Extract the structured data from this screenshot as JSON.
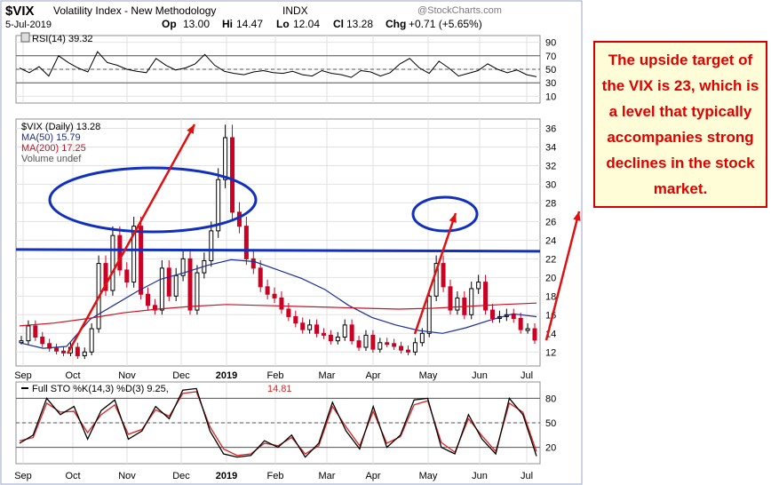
{
  "header": {
    "symbol": "$VIX",
    "name": "Volatility Index - New Methodology",
    "exchange": "INDX",
    "date": "5-Jul-2019",
    "watermark": "@StockCharts.com",
    "quote": {
      "op_label": "Op",
      "op": "13.00",
      "hi_label": "Hi",
      "hi": "14.47",
      "lo_label": "Lo",
      "lo": "12.04",
      "cl_label": "Cl",
      "cl": "13.28",
      "chg_label": "Chg",
      "chg": "+0.71 (+5.65%)"
    }
  },
  "callout_text": "The upside target of the VIX is 23, which is a level that typically accompanies strong declines in the stock market.",
  "colors": {
    "up": "#000000",
    "down": "#cc0022",
    "ma50": "#1a2e9a",
    "ma200": "#cc1122",
    "annotation_blue": "#1030c0",
    "annotation_red": "#e01010",
    "kline": "#000000",
    "dline": "#dd2222"
  },
  "chart_data": [
    {
      "type": "line",
      "title": "RSI(14) 39.32",
      "legend": [
        "RSI(14) 39.32"
      ],
      "yticks": [
        10,
        30,
        50,
        70,
        90
      ],
      "ylim": [
        0,
        100
      ],
      "guides": [
        30,
        50,
        70
      ],
      "x": [
        "Sep",
        "Oct",
        "Nov",
        "Dec",
        "2019",
        "Feb",
        "Mar",
        "Apr",
        "May",
        "Jun",
        "Jul"
      ],
      "series": [
        {
          "name": "RSI(14)",
          "values": [
            52,
            45,
            54,
            40,
            70,
            60,
            52,
            46,
            76,
            60,
            56,
            50,
            47,
            45,
            66,
            56,
            49,
            52,
            58,
            72,
            56,
            47,
            44,
            42,
            46,
            48,
            45,
            44,
            47,
            42,
            40,
            48,
            44,
            42,
            38,
            48,
            46,
            40,
            45,
            58,
            66,
            52,
            44,
            62,
            52,
            40,
            44,
            48,
            58,
            50,
            45,
            49,
            42,
            39
          ]
        }
      ]
    },
    {
      "type": "candlestick",
      "title": "$VIX (Daily) 13.28",
      "legend": [
        "$VIX (Daily) 13.28",
        "MA(50) 15.79",
        "MA(200) 17.25",
        "Volume undef"
      ],
      "yticks": [
        12,
        14,
        16,
        18,
        20,
        22,
        24,
        26,
        28,
        30,
        32,
        34,
        36
      ],
      "ylim": [
        10.5,
        37
      ],
      "x": [
        "Sep",
        "Oct",
        "Nov",
        "Dec",
        "2019",
        "Feb",
        "Mar",
        "Apr",
        "May",
        "Jun",
        "Jul"
      ],
      "series": [
        {
          "name": "$VIX",
          "values": [
            13.2,
            14.8,
            13.6,
            12.9,
            12.4,
            12.1,
            11.9,
            12.5,
            11.6,
            12.0,
            14.5,
            21.5,
            18.6,
            24.5,
            20.8,
            19.5,
            25.5,
            18.2,
            17.0,
            16.5,
            21.0,
            18.0,
            20.2,
            22.0,
            16.5,
            20.5,
            21.8,
            25.0,
            30.5,
            35.0,
            27.0,
            25.5,
            22.0,
            21.0,
            19.0,
            18.2,
            17.8,
            16.6,
            15.8,
            15.1,
            14.4,
            14.9,
            14.0,
            13.8,
            13.2,
            13.6,
            14.9,
            13.2,
            12.5,
            13.8,
            12.3,
            13.0,
            12.9,
            12.6,
            12.2,
            12.0,
            13.0,
            14.0,
            18.0,
            21.5,
            19.0,
            16.5,
            17.8,
            16.0,
            18.8,
            19.5,
            16.5,
            15.6,
            15.8,
            16.0,
            15.6,
            14.4,
            14.5,
            13.28
          ]
        },
        {
          "name": "MA(50)",
          "values": [
            13.0,
            12.4,
            12.6,
            15.5,
            17.0,
            18.5,
            19.8,
            20.5,
            21.3,
            21.9,
            21.7,
            20.8,
            19.9,
            18.7,
            17.0,
            15.7,
            14.9,
            14.3,
            14.0,
            14.6,
            15.4,
            16.1,
            15.79
          ]
        },
        {
          "name": "MA(200)",
          "values": [
            14.8,
            15.1,
            15.6,
            16.2,
            16.6,
            16.9,
            17.1,
            17.0,
            16.9,
            16.8,
            16.7,
            16.6,
            16.7,
            16.9,
            17.1,
            17.25
          ]
        }
      ],
      "annotations": {
        "horizontal_line": 23,
        "target": 23
      }
    },
    {
      "type": "line",
      "title": "Full STO %K(14,3) %D(3) 9.25, 14.81",
      "legend": [
        "Full STO %K(14,3) %D(3) 9.25,",
        "14.81"
      ],
      "yticks": [
        20,
        50,
        80
      ],
      "ylim": [
        0,
        100
      ],
      "guides": [
        20,
        50,
        80
      ],
      "x": [
        "Sep",
        "Oct",
        "Nov",
        "Dec",
        "2019",
        "Feb",
        "Mar",
        "Apr",
        "May",
        "Jun",
        "Jul"
      ],
      "series": [
        {
          "name": "%K",
          "values": [
            25,
            35,
            80,
            60,
            70,
            30,
            65,
            78,
            30,
            40,
            70,
            55,
            90,
            92,
            40,
            12,
            8,
            10,
            28,
            20,
            35,
            8,
            25,
            75,
            40,
            18,
            70,
            20,
            35,
            78,
            80,
            20,
            12,
            60,
            30,
            12,
            80,
            60,
            9.25
          ]
        },
        {
          "name": "%D",
          "values": [
            28,
            32,
            74,
            63,
            64,
            38,
            60,
            72,
            36,
            42,
            66,
            58,
            86,
            88,
            45,
            18,
            10,
            12,
            25,
            22,
            32,
            12,
            22,
            70,
            45,
            22,
            64,
            25,
            33,
            72,
            77,
            26,
            14,
            55,
            34,
            15,
            74,
            63,
            14.81
          ]
        }
      ]
    }
  ]
}
